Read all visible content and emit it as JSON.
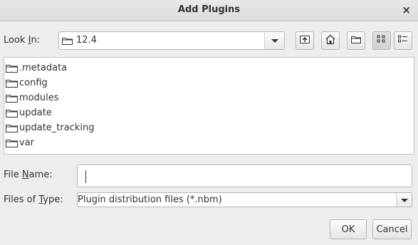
{
  "window": {
    "title": "Add Plugins",
    "close_glyph": "×"
  },
  "look_in": {
    "label_prefix": "Look ",
    "label_mnemonic": "I",
    "label_suffix": "n:",
    "value": "12.4"
  },
  "toolbar": {
    "icons": [
      "up-folder-icon",
      "home-icon",
      "new-folder-icon",
      "list-view-icon",
      "details-view-icon"
    ]
  },
  "files": [
    ".metadata",
    "config",
    "modules",
    "update",
    "update_tracking",
    "var"
  ],
  "file_name": {
    "label_prefix": "File ",
    "label_mnemonic": "N",
    "label_suffix": "ame:",
    "value": ""
  },
  "file_type": {
    "label_prefix": "Files of ",
    "label_mnemonic": "T",
    "label_suffix": "ype:",
    "value": "Plugin distribution files (*.nbm)"
  },
  "buttons": {
    "ok": "OK",
    "cancel": "Cancel"
  }
}
